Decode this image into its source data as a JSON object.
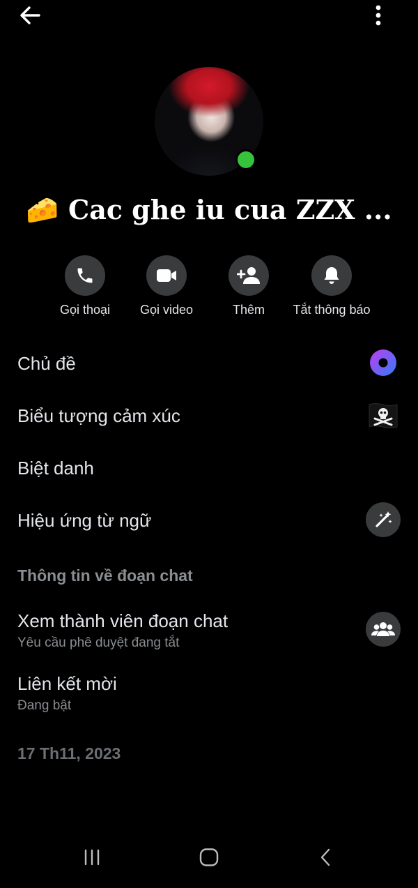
{
  "header": {
    "back_icon": "arrow-left-icon",
    "more_icon": "more-vertical-icon"
  },
  "profile": {
    "title": "🧀 Cac ghe iu cua ZZX ...",
    "online_color": "#37c23c"
  },
  "actions": [
    {
      "label": "Gọi thoại",
      "icon": "phone-icon"
    },
    {
      "label": "Gọi video",
      "icon": "video-camera-icon"
    },
    {
      "label": "Thêm",
      "icon": "add-person-icon"
    },
    {
      "label": "Tắt thông báo",
      "icon": "bell-icon"
    }
  ],
  "settings": [
    {
      "title": "Chủ đề",
      "icon": "theme-color-icon"
    },
    {
      "title": "Biểu tượng cảm xúc",
      "icon": "pirate-flag-emoji"
    },
    {
      "title": "Biệt danh"
    },
    {
      "title": "Hiệu ứng từ ngữ",
      "icon": "magic-wand-icon"
    }
  ],
  "chat_info": {
    "header": "Thông tin về đoạn chat",
    "members": {
      "title": "Xem thành viên đoạn chat",
      "subtitle": "Yêu cầu phê duyệt đang tắt",
      "icon": "group-icon"
    },
    "invite_link": {
      "title": "Liên kết mời",
      "subtitle": "Đang bật"
    }
  },
  "footer": {
    "date": "17 Th11, 2023"
  },
  "system_nav": {
    "recents_icon": "recents-icon",
    "home_icon": "home-icon",
    "back_icon": "back-chevron-icon"
  },
  "colors": {
    "background": "#000000",
    "button_bg": "#3a3b3c",
    "text_primary": "#e4e6eb",
    "text_secondary": "#8a8d91",
    "theme_gradient_start": "#c13ef0",
    "theme_gradient_end": "#2f7df6"
  }
}
